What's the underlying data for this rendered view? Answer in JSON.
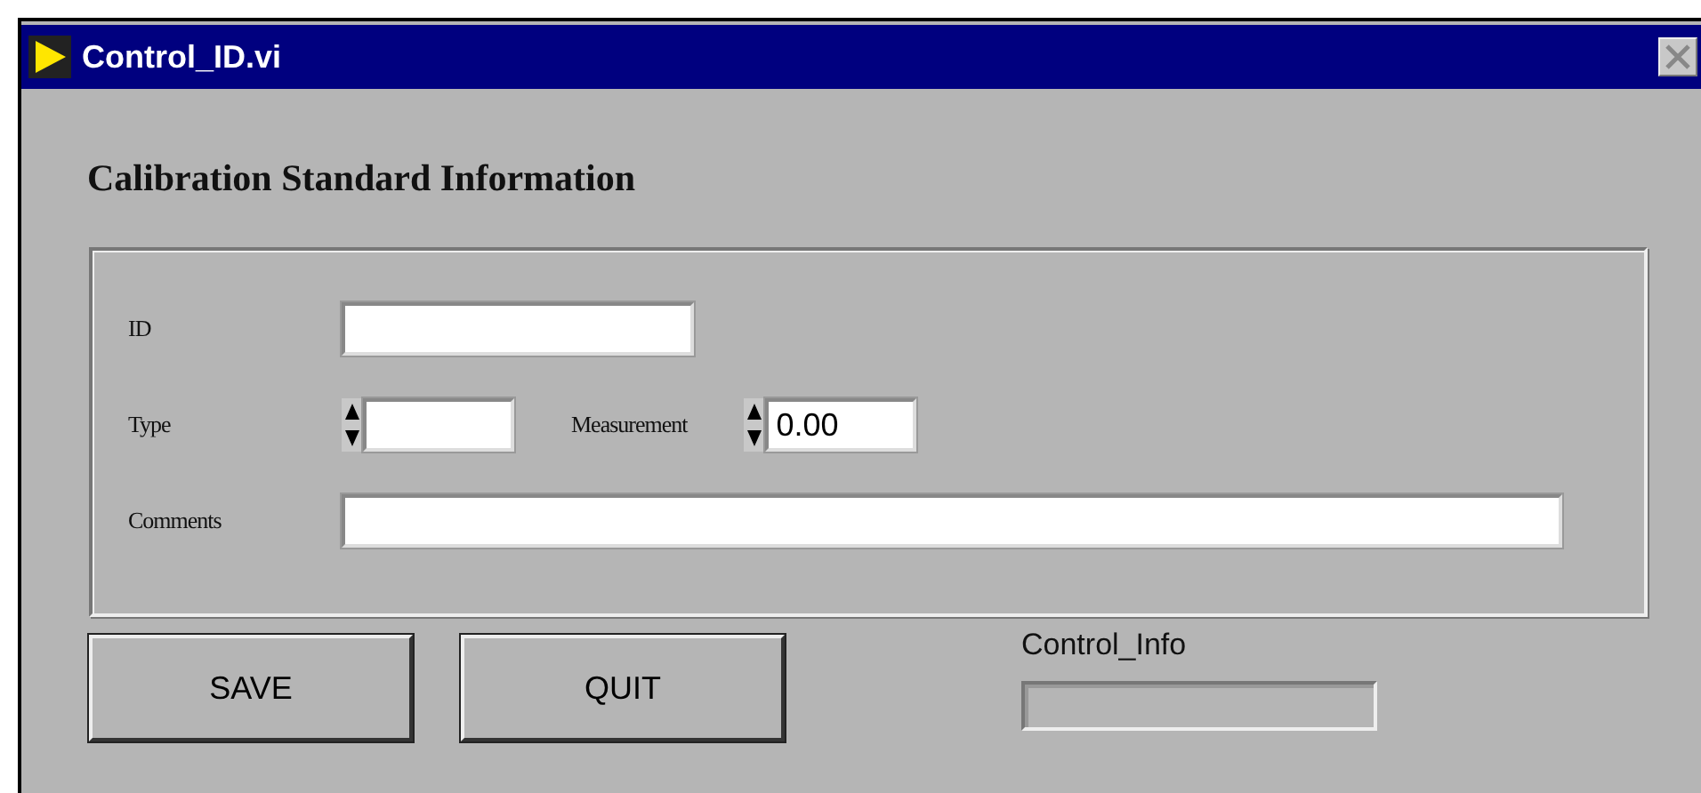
{
  "window": {
    "title": "Control_ID.vi"
  },
  "heading": "Calibration Standard Information",
  "fields": [
    {
      "kind": "text",
      "label": "ID"
    },
    {
      "kind": "numeric",
      "label": "Type"
    },
    {
      "kind": "numeric",
      "label": "Measurement",
      "value": "0.00"
    },
    {
      "kind": "wide",
      "label": "Comments"
    }
  ],
  "buttons": [
    "SAVE",
    "QUIT"
  ],
  "indicator": {
    "label": "Control_Info"
  }
}
